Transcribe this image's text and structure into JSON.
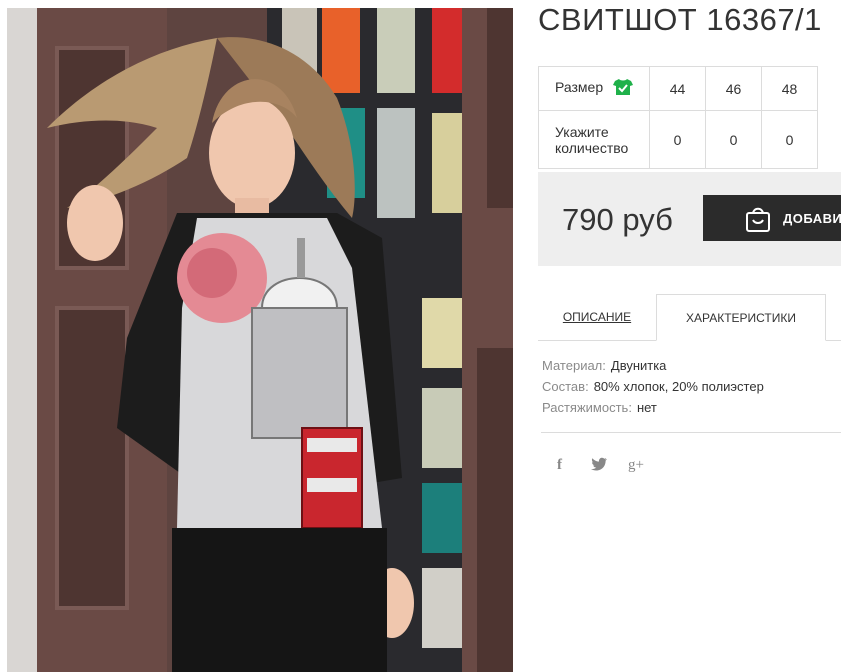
{
  "product": {
    "title": "СВИТШОТ 16367/1"
  },
  "size_table": {
    "size_label": "Размер",
    "quantity_label_line1": "Укажите",
    "quantity_label_line2": "количество",
    "sizes": [
      "44",
      "46",
      "48"
    ],
    "quantities": [
      "0",
      "0",
      "0"
    ],
    "icon": "tshirt-check-icon",
    "icon_color": "#1fb14a"
  },
  "purchase": {
    "price": "790 руб",
    "add_to_cart_label": "ДОБАВИТЬ",
    "button_color": "#2b2b2b",
    "icon": "shopping-bag-icon"
  },
  "tabs": {
    "description": "ОПИСАНИЕ",
    "characteristics": "ХАРАКТЕРИСТИКИ",
    "active": "characteristics"
  },
  "characteristics": [
    {
      "key": "Материал:",
      "value": "Двунитка"
    },
    {
      "key": "Состав:",
      "value": "80% хлопок, 20% полиэстер"
    },
    {
      "key": "Растяжимость:",
      "value": "нет"
    }
  ],
  "social": {
    "facebook": "f",
    "twitter": "twitter-icon",
    "googleplus": "g+"
  }
}
